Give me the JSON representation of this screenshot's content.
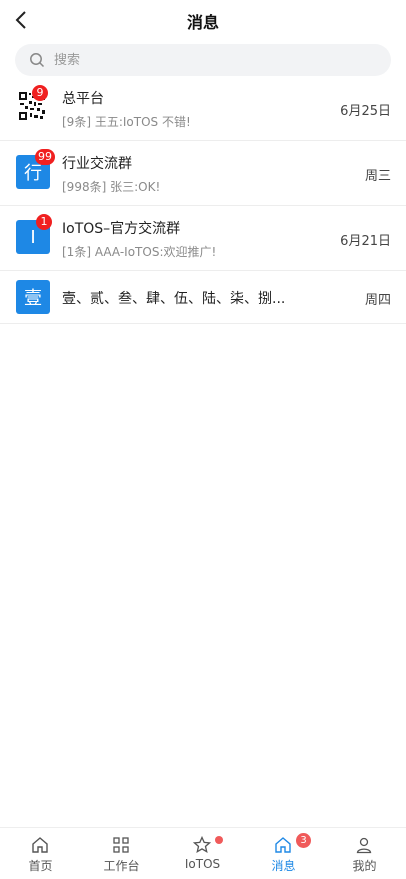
{
  "header": {
    "title": "消息"
  },
  "search": {
    "placeholder": "搜索"
  },
  "conversations": [
    {
      "avatar_text": "",
      "badge": "9",
      "name": "总平台",
      "preview": "[9条] 王五:IoTOS 不错!",
      "time": "6月25日"
    },
    {
      "avatar_text": "行",
      "badge": "99",
      "name": "行业交流群",
      "preview": "[998条] 张三:OK!",
      "time": "周三"
    },
    {
      "avatar_text": "I",
      "badge": "1",
      "name": "IoTOS–官方交流群",
      "preview": "[1条] AAA-IoTOS:欢迎推广!",
      "time": "6月21日"
    },
    {
      "avatar_text": "壹",
      "badge": "",
      "name": "壹、贰、叁、肆、伍、陆、柒、捌...",
      "preview": "",
      "time": "周四"
    }
  ],
  "tabbar": {
    "tabs": [
      {
        "label": "首页",
        "icon": "home-icon"
      },
      {
        "label": "工作台",
        "icon": "grid-icon"
      },
      {
        "label": "IoTOS",
        "icon": "star-icon"
      },
      {
        "label": "消息",
        "icon": "home-icon",
        "badge": "3",
        "active": true
      },
      {
        "label": "我的",
        "icon": "user-icon"
      }
    ]
  },
  "colors": {
    "accent": "#1e88e5",
    "badge": "#f02020",
    "tab_badge": "#f05a5a"
  }
}
